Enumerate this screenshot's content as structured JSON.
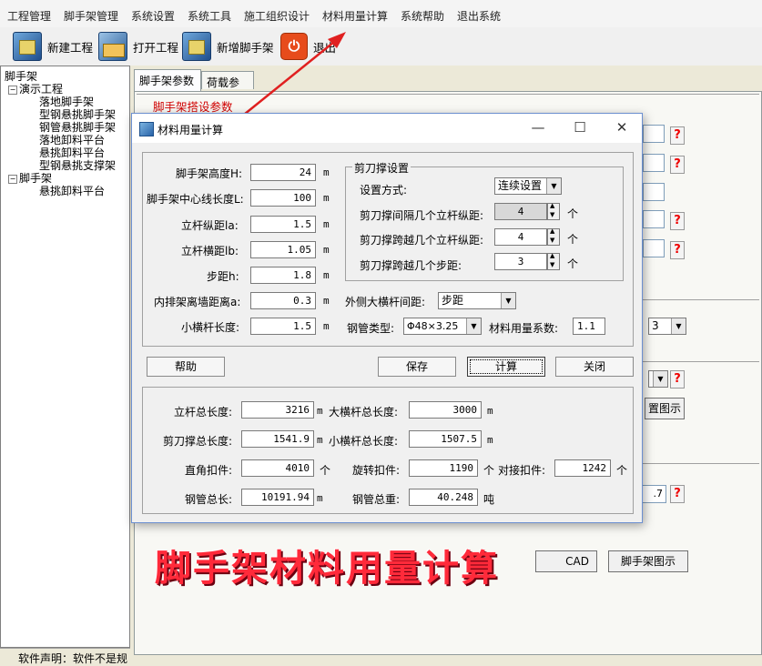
{
  "menu": [
    "工程管理",
    "脚手架管理",
    "系统设置",
    "系统工具",
    "施工组织设计",
    "材料用量计算",
    "系统帮助",
    "退出系统"
  ],
  "toolbar": {
    "new_project": "新建工程",
    "open_project": "打开工程",
    "add_scaffold": "新增脚手架",
    "exit": "退出"
  },
  "tree": {
    "root": "脚手架",
    "demo_project": "演示工程",
    "demo_items": [
      "落地脚手架",
      "型钢悬挑脚手架",
      "钢管悬挑脚手架",
      "落地卸料平台",
      "悬挑卸料平台",
      "型钢悬挑支撑架"
    ],
    "scaffold_group": "脚手架",
    "scaffold_items": [
      "悬挑卸料平台"
    ]
  },
  "status_text": "软件声明：软件不是规",
  "main": {
    "tabs": [
      "脚手架参数",
      "荷载参数"
    ],
    "section_title": "脚手架搭设参数",
    "partial_combo": "3",
    "partial_value": ".7",
    "diagram_button": "置图示",
    "cad_button": "CAD",
    "scaffold_diagram_button": "脚手架图示"
  },
  "dialog": {
    "title": "材料用量计算",
    "win_minimize": "—",
    "win_maximize": "☐",
    "win_close": "✕",
    "params": [
      {
        "label": "脚手架高度H:",
        "value": "24",
        "unit": "m"
      },
      {
        "label": "脚手架中心线长度L:",
        "value": "100",
        "unit": "m"
      },
      {
        "label": "立杆纵距la:",
        "value": "1.5",
        "unit": "m"
      },
      {
        "label": "立杆横距lb:",
        "value": "1.05",
        "unit": "m"
      },
      {
        "label": "步距h:",
        "value": "1.8",
        "unit": "m"
      },
      {
        "label": "内排架离墙距离a:",
        "value": "0.3",
        "unit": "m"
      },
      {
        "label": "小横杆长度:",
        "value": "1.5",
        "unit": "m"
      }
    ],
    "scissor": {
      "group_title": "剪刀撑设置",
      "mode_label": "设置方式:",
      "mode_value": "连续设置",
      "interval_label": "剪刀撑间隔几个立杆纵距:",
      "interval_value": "4",
      "span_label": "剪刀撑跨越几个立杆纵距:",
      "span_value": "4",
      "steps_label": "剪刀撑跨越几个步距:",
      "steps_value": "3",
      "unit": "个"
    },
    "outer_bar_label": "外侧大横杆间距:",
    "outer_bar_value": "步距",
    "pipe_type_label": "钢管类型:",
    "pipe_type_value": "Φ48×3.25",
    "coef_label": "材料用量系数:",
    "coef_value": "1.1",
    "buttons": {
      "help": "帮助",
      "save": "保存",
      "calc": "计算",
      "close": "关闭"
    },
    "results": {
      "pole_total_label": "立杆总长度:",
      "pole_total_value": "3216",
      "pole_total_unit": "m",
      "big_bar_label": "大横杆总长度:",
      "big_bar_value": "3000",
      "big_bar_unit": "m",
      "scissor_total_label": "剪刀撑总长度:",
      "scissor_total_value": "1541.9",
      "scissor_total_unit": "m",
      "small_bar_label": "小横杆总长度:",
      "small_bar_value": "1507.5",
      "small_bar_unit": "m",
      "right_angle_label": "直角扣件:",
      "right_angle_value": "4010",
      "right_angle_unit": "个",
      "swivel_label": "旋转扣件:",
      "swivel_value": "1190",
      "swivel_unit": "个",
      "butt_label": "对接扣件:",
      "butt_value": "1242",
      "butt_unit": "个",
      "pipe_len_label": "钢管总长:",
      "pipe_len_value": "10191.94",
      "pipe_len_unit": "m",
      "pipe_weight_label": "钢管总重:",
      "pipe_weight_value": "40.248",
      "pipe_weight_unit": "吨"
    }
  },
  "banner": "脚手架材料用量计算",
  "colors": {
    "accent_red": "#ff2a3a",
    "arrow_red": "#e02020"
  }
}
